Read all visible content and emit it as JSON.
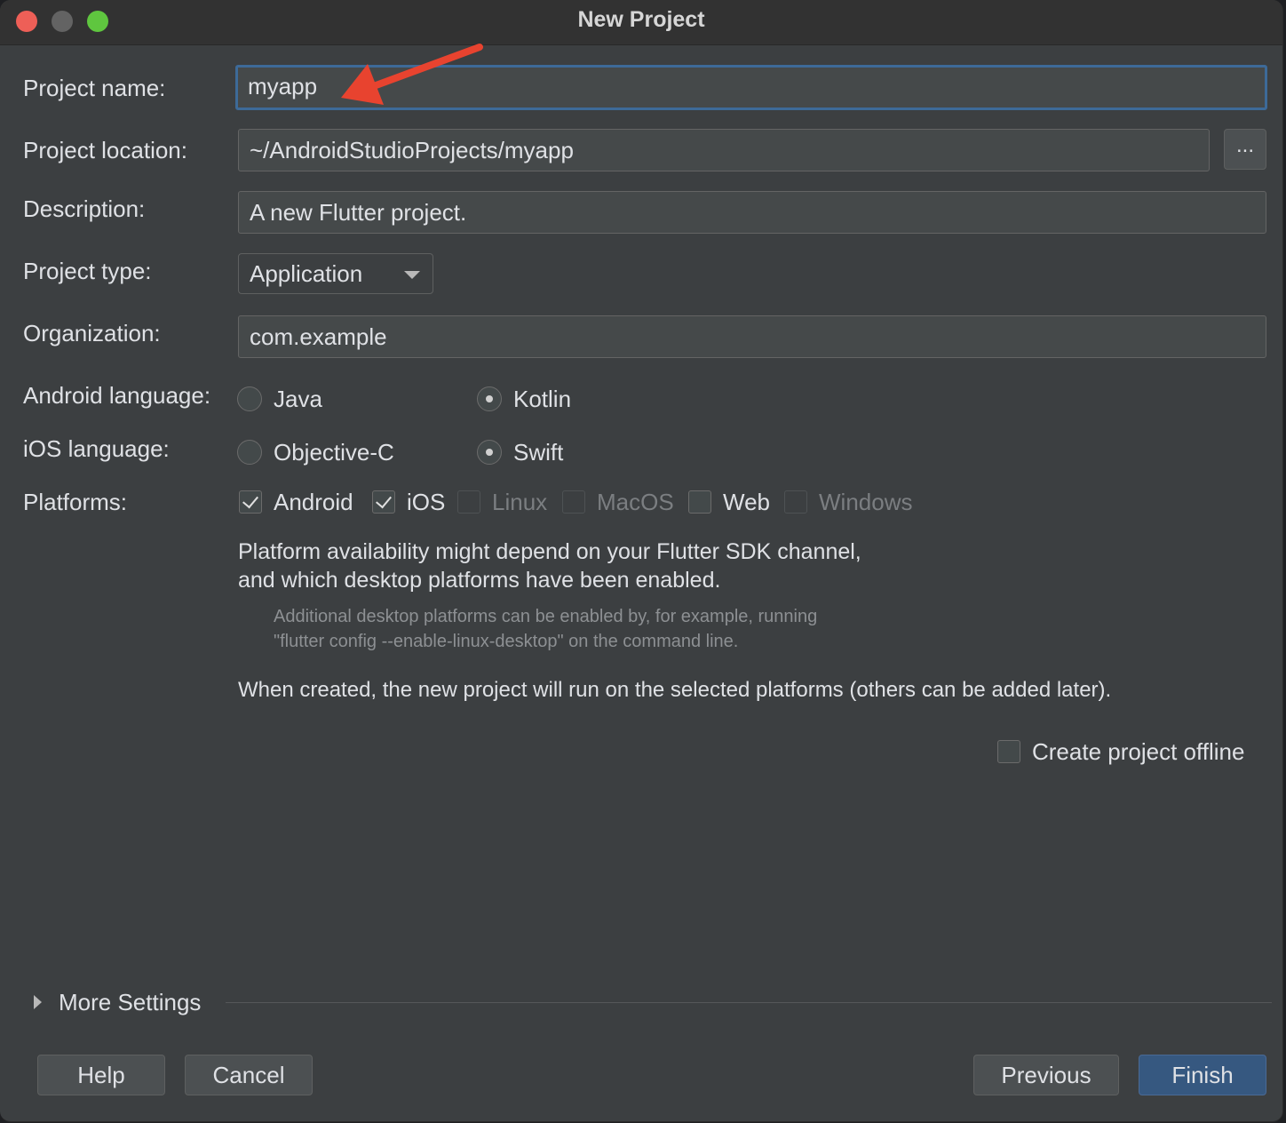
{
  "window": {
    "title": "New Project"
  },
  "form": {
    "project_name": {
      "label": "Project name:",
      "value": "myapp"
    },
    "project_location": {
      "label": "Project location:",
      "value": "~/AndroidStudioProjects/myapp",
      "browse_label": "..."
    },
    "description": {
      "label": "Description:",
      "value": "A new Flutter project."
    },
    "project_type": {
      "label": "Project type:",
      "value": "Application"
    },
    "organization": {
      "label": "Organization:",
      "value": "com.example"
    },
    "android_language": {
      "label": "Android language:",
      "options": [
        "Java",
        "Kotlin"
      ],
      "selected": "Kotlin"
    },
    "ios_language": {
      "label": "iOS language:",
      "options": [
        "Objective-C",
        "Swift"
      ],
      "selected": "Swift"
    },
    "platforms": {
      "label": "Platforms:",
      "items": [
        {
          "label": "Android",
          "checked": true,
          "enabled": true
        },
        {
          "label": "iOS",
          "checked": true,
          "enabled": true
        },
        {
          "label": "Linux",
          "checked": false,
          "enabled": false
        },
        {
          "label": "MacOS",
          "checked": false,
          "enabled": false
        },
        {
          "label": "Web",
          "checked": false,
          "enabled": true
        },
        {
          "label": "Windows",
          "checked": false,
          "enabled": false
        }
      ]
    },
    "platform_info_line1": "Platform availability might depend on your Flutter SDK channel,",
    "platform_info_line2": "and which desktop platforms have been enabled.",
    "platform_note_line1": "Additional desktop platforms can be enabled by, for example, running",
    "platform_note_line2": "\"flutter config --enable-linux-desktop\" on the command line.",
    "created_info": "When created, the new project will run on the selected platforms (others can be added later).",
    "create_offline": {
      "label": "Create project offline",
      "checked": false
    }
  },
  "more_settings": {
    "label": "More Settings",
    "expanded": false
  },
  "buttons": {
    "help": "Help",
    "cancel": "Cancel",
    "previous": "Previous",
    "finish": "Finish"
  },
  "colors": {
    "focus_border": "#3d6a98",
    "primary_button": "#365880",
    "annotation_arrow": "#e8432f"
  }
}
